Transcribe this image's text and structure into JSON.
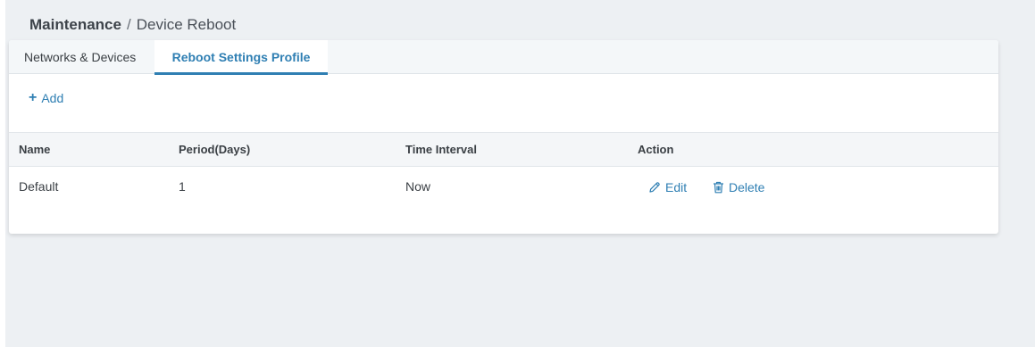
{
  "breadcrumb": {
    "root": "Maintenance",
    "separator": "/",
    "current": "Device Reboot"
  },
  "tabs": [
    {
      "label": "Networks & Devices",
      "active": false
    },
    {
      "label": "Reboot Settings Profile",
      "active": true
    }
  ],
  "toolbar": {
    "add_label": "Add",
    "add_icon": "plus-icon"
  },
  "table": {
    "columns": [
      "Name",
      "Period(Days)",
      "Time Interval",
      "Action"
    ],
    "rows": [
      {
        "name": "Default",
        "period": "1",
        "interval": "Now",
        "actions": {
          "edit_label": "Edit",
          "edit_icon": "pencil-icon",
          "delete_label": "Delete",
          "delete_icon": "trash-icon"
        }
      }
    ]
  },
  "colors": {
    "accent": "#2f7fb3",
    "background": "#edf0f3",
    "card": "#ffffff",
    "header_bg": "#f4f6f8",
    "text": "#3a3f44"
  }
}
